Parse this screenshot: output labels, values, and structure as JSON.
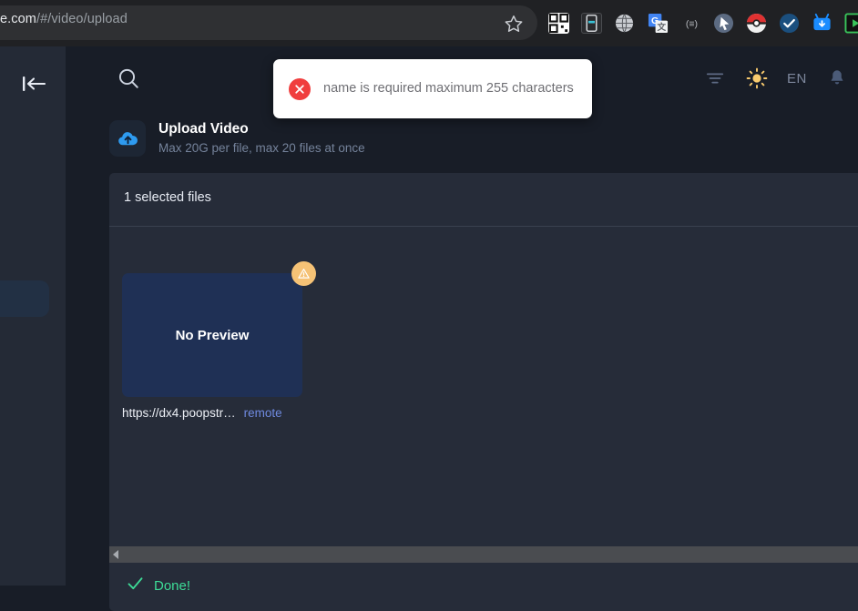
{
  "browser": {
    "url_host": "e.com",
    "url_path": "/#/video/upload",
    "star_icon": "bookmark-star-icon",
    "extensions": [
      {
        "name": "qr-code-extension-icon"
      },
      {
        "name": "mobile-device-extension-icon"
      },
      {
        "name": "globe-extension-icon"
      },
      {
        "name": "google-translate-extension-icon"
      },
      {
        "name": "equals-extension-icon"
      },
      {
        "name": "cursor-extension-icon"
      },
      {
        "name": "pokeball-extension-icon"
      },
      {
        "name": "checkmark-extension-icon"
      },
      {
        "name": "video-downloader-extension-icon"
      },
      {
        "name": "play-extension-icon"
      }
    ]
  },
  "sidebar": {
    "collapse_icon": "collapse-sidebar-icon"
  },
  "header": {
    "search_icon": "search-icon",
    "filter_icon": "filter-lines-icon",
    "theme_icon": "sun-icon",
    "language": "EN",
    "bell_icon": "notification-bell-icon"
  },
  "upload": {
    "icon": "cloud-upload-icon",
    "title": "Upload Video",
    "subtitle": "Max 20G per file, max 20 files at once"
  },
  "files": {
    "selected_label": "1 selected files",
    "items": [
      {
        "preview_label": "No Preview",
        "name": "https://dx4.poopstr…",
        "source": "remote",
        "badge_icon": "warning-triangle-icon"
      }
    ]
  },
  "status": {
    "icon": "check-icon",
    "text": "Done!"
  },
  "toast": {
    "icon": "error-circle-icon",
    "message": "name is required maximum 255 characters"
  },
  "colors": {
    "accent_blue": "#2e9bf0",
    "error_red": "#f03e3e",
    "success_green": "#3ddc97",
    "warning_amber": "#f5c276",
    "remote_link": "#6f8ae0",
    "panel_bg": "#262c39",
    "page_bg": "#181d27",
    "sidebar_bg": "#242a36",
    "thumb_bg": "#1f3055"
  }
}
